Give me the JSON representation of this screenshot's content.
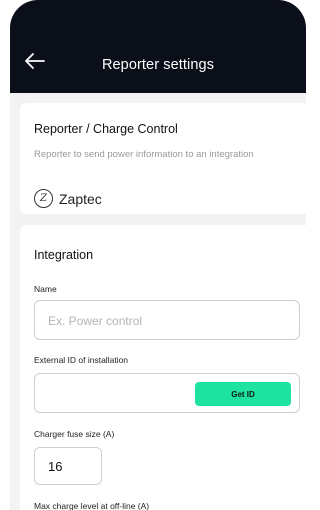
{
  "header": {
    "title": "Reporter settings",
    "back_icon": "arrow-left-icon"
  },
  "reporter_card": {
    "title": "Reporter / Charge Control",
    "description": "Reporter to send power information to an integration",
    "brand_logo_letter": "Z",
    "brand_name": "Zaptec"
  },
  "integration_card": {
    "title": "Integration",
    "name_label": "Name",
    "name_placeholder": "Ex. Power control",
    "name_value": "",
    "external_id_label": "External ID of installation",
    "external_id_value": "",
    "get_id_label": "Get ID",
    "fuse_label": "Charger fuse size (A)",
    "fuse_value": "16",
    "max_charge_label": "Max charge level at off-line (A)"
  },
  "colors": {
    "topbar": "#0b0f1a",
    "accent": "#1ee3a0",
    "background": "#f3f3f3"
  }
}
